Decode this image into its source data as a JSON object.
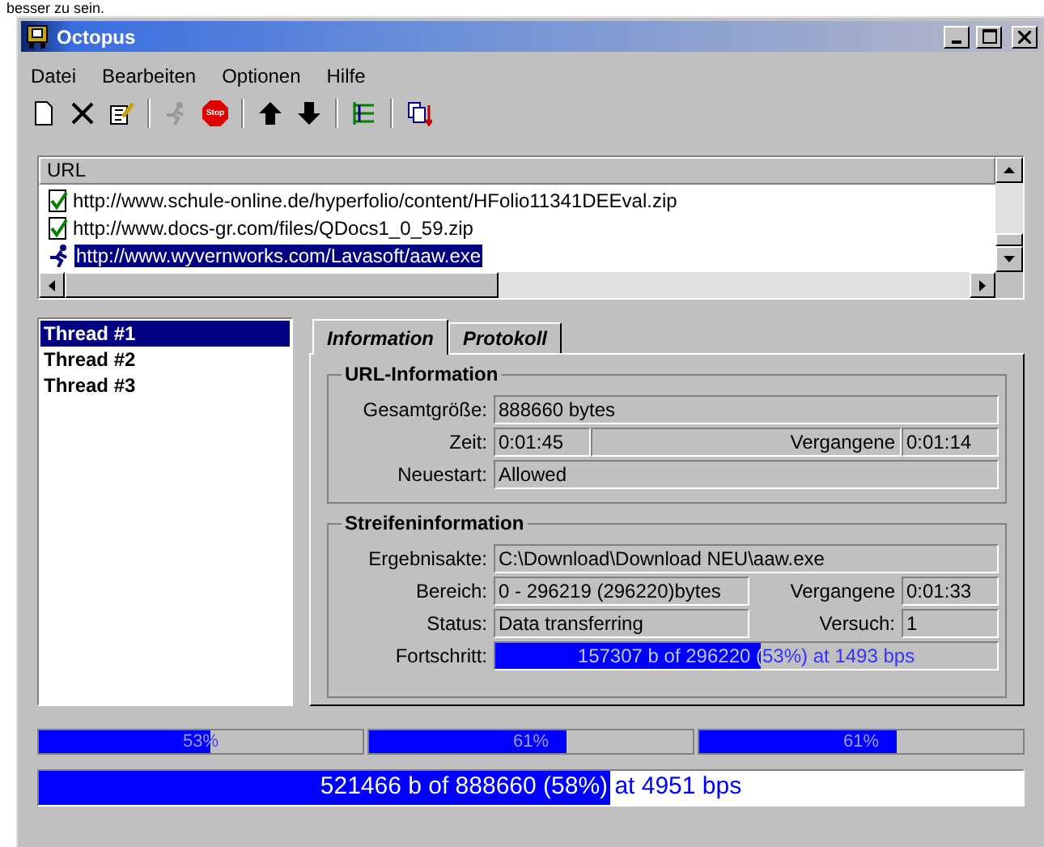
{
  "background_text": "besser zu sein.",
  "window": {
    "title": "Octopus"
  },
  "menu": [
    "Datei",
    "Bearbeiten",
    "Optionen",
    "Hilfe"
  ],
  "toolbar": [
    {
      "kind": "new",
      "disabled": false
    },
    {
      "kind": "delete",
      "disabled": false
    },
    {
      "kind": "edit",
      "disabled": false
    },
    {
      "kind": "sep"
    },
    {
      "kind": "run",
      "disabled": true
    },
    {
      "kind": "stop",
      "disabled": false,
      "label": "Stop"
    },
    {
      "kind": "sep"
    },
    {
      "kind": "up",
      "disabled": false
    },
    {
      "kind": "down",
      "disabled": false
    },
    {
      "kind": "sep"
    },
    {
      "kind": "tree",
      "disabled": false
    },
    {
      "kind": "sep"
    },
    {
      "kind": "copy",
      "disabled": false
    }
  ],
  "url_list": {
    "column": "URL",
    "rows": [
      {
        "url": "http://www.schule-online.de/hyperfolio/content/HFolio11341DEEval.zip",
        "kind": "done",
        "selected": false
      },
      {
        "url": "http://www.docs-gr.com/files/QDocs1_0_59.zip",
        "kind": "done",
        "selected": false
      },
      {
        "url": "http://www.wyvernworks.com/Lavasoft/aaw.exe",
        "kind": "running",
        "selected": true
      }
    ]
  },
  "threads": [
    {
      "label": "Thread #1",
      "selected": true
    },
    {
      "label": "Thread #2",
      "selected": false
    },
    {
      "label": "Thread #3",
      "selected": false
    }
  ],
  "tabs": [
    {
      "label": "Information",
      "selected": true
    },
    {
      "label": "Protokoll",
      "selected": false
    }
  ],
  "url_info": {
    "title": "URL-Information",
    "size_label": "Gesamtgröße:",
    "size": "888660 bytes",
    "time_label": "Zeit:",
    "time": "0:01:45",
    "elapsed_label": "Vergangene",
    "elapsed": "0:01:14",
    "restart_label": "Neuestart:",
    "restart": "Allowed"
  },
  "stripe_info": {
    "title": "Streifeninformation",
    "file_label": "Ergebnisakte:",
    "file": "C:\\Download\\Download  NEU\\aaw.exe",
    "range_label": "Bereich:",
    "range": "0 - 296219 (296220)bytes",
    "elapsed_label": "Vergangene",
    "elapsed": "0:01:33",
    "status_label": "Status:",
    "status": "Data transferring",
    "try_label": "Versuch:",
    "try": "1",
    "progress_label": "Fortschritt:",
    "progress_text": "157307 b of 296220 (53%) at 1493 bps",
    "level": 0.53
  },
  "thread_bars": [
    {
      "text": "53%",
      "level": 0.53
    },
    {
      "text": "61%",
      "level": 0.61
    },
    {
      "text": "61%",
      "level": 0.61
    }
  ],
  "total": {
    "text": "521466 b of 888660 (58%) at 4951 bps",
    "level": 0.58
  }
}
